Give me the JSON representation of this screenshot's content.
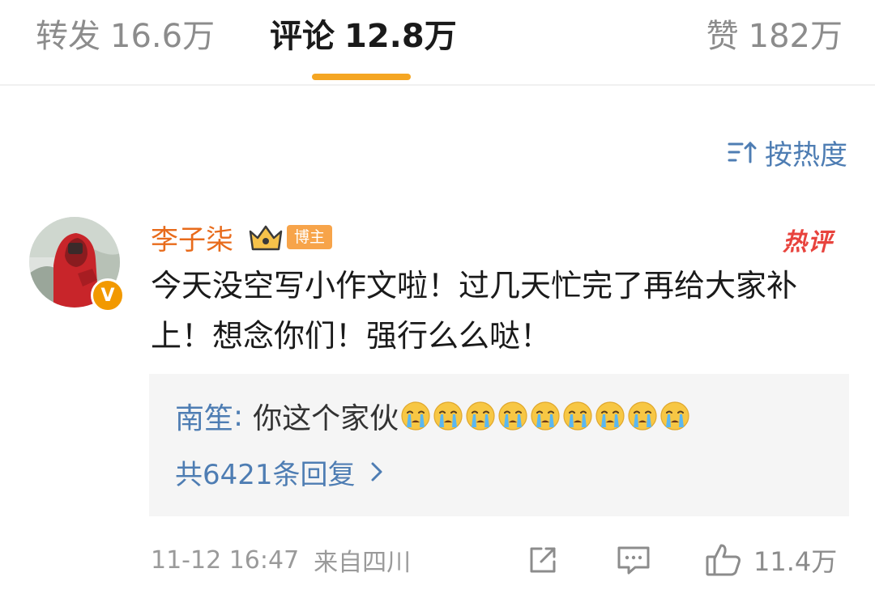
{
  "tabs": {
    "repost": {
      "label": "转发",
      "count": "16.6万"
    },
    "comments": {
      "label": "评论",
      "count": "12.8万"
    },
    "likes": {
      "label": "赞",
      "count": "182万"
    }
  },
  "sort": {
    "label": "按热度",
    "icon": "sort-icon"
  },
  "comment": {
    "author": "李子柒",
    "role_tag": "博主",
    "verified_badge": "V",
    "hot_label": "热评",
    "text": "今天没空写小作文啦！过几天忙完了再给大家补上！想念你们！强行么么哒！",
    "reply": {
      "author": "南笙",
      "separator": ":",
      "text": "你这个家伙",
      "emoji": "crying-face-emoji",
      "emoji_count": 9
    },
    "more_replies": "共6421条回复",
    "date": "11-12 16:47",
    "location": "来自四川",
    "like_count": "11.4万"
  },
  "colors": {
    "accent": "#f5a623",
    "link": "#4e7db3",
    "author": "#e86b1b",
    "hot": "#e8433d",
    "muted": "#9a9a9a"
  }
}
